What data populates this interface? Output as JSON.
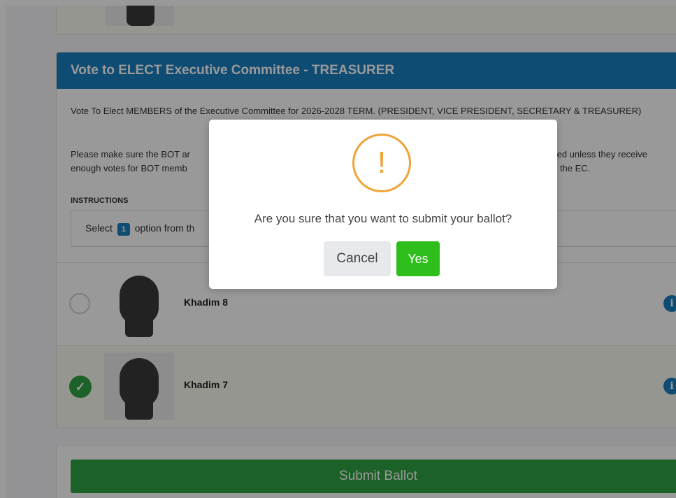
{
  "prev_card": {},
  "section": {
    "title": "Vote to ELECT Executive Committee - TREASURER",
    "description": "Vote To Elect MEMBERS of the Executive Committee for 2026-2028 TERM. (PRESIDENT, VICE PRESIDENT, SECRETARY & TREASURER)",
    "note_start": "Please make sure the BOT ar",
    "note_start_line2": "enough votes for BOT memb",
    "note_end": "ted unless they receive",
    "note_end_line2": "r the EC.",
    "instructions_title": "INSTRUCTIONS",
    "instruction_prefix": "Select",
    "instruction_count": "1",
    "instruction_suffix": "option from th"
  },
  "candidates": [
    {
      "name": "Khadim 8",
      "selected": false,
      "info_icon": "i"
    },
    {
      "name": "Khadim 7",
      "selected": true,
      "info_icon": "i"
    }
  ],
  "submit": {
    "label": "Submit Ballot"
  },
  "dialog": {
    "icon": "!",
    "message": "Are you sure that you want to submit your ballot?",
    "cancel_label": "Cancel",
    "confirm_label": "Yes"
  },
  "colors": {
    "header_blue": "#1a7fc2",
    "submit_green": "#2fa343",
    "yes_green": "#2fbf1c",
    "warning_orange": "#f0a336"
  }
}
